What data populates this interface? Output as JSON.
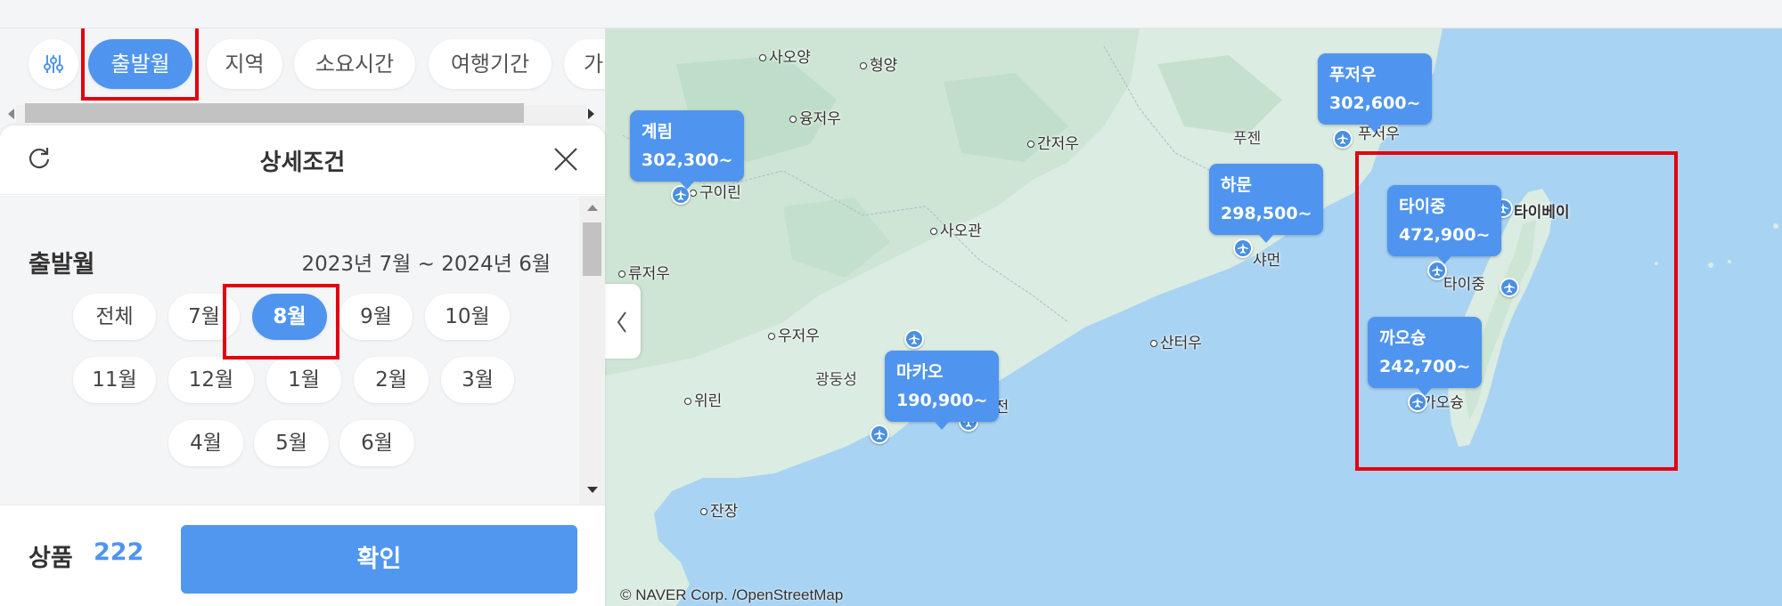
{
  "filters": {
    "chips": [
      "출발월",
      "지역",
      "소요시간",
      "여행기간",
      "가"
    ],
    "active_chip": "출발월"
  },
  "panel": {
    "title": "상세조건",
    "section_title": "출발월",
    "range_text": "2023년 7월 ~ 2024년 6월",
    "months": [
      "전체",
      "7월",
      "8월",
      "9월",
      "10월",
      "11월",
      "12월",
      "1월",
      "2월",
      "3월",
      "4월",
      "5월",
      "6월"
    ],
    "selected_month": "8월",
    "footer": {
      "product_label": "상품",
      "product_count": "222",
      "confirm_label": "확인"
    }
  },
  "map": {
    "attribution": "© NAVER Corp. /OpenStreetMap",
    "labels": [
      "사오양",
      "형양",
      "융저우",
      "간저우",
      "구이린",
      "사오관",
      "류저우",
      "우저우",
      "광둥성",
      "위린",
      "산터우",
      "잔장",
      "푸젠",
      "샤먼",
      "푸저우",
      "타이베이",
      "타이중",
      "가오슝",
      "선전"
    ],
    "price_bubbles": [
      {
        "city": "계림",
        "price": "302,300~"
      },
      {
        "city": "푸저우",
        "price": "302,600~"
      },
      {
        "city": "하문",
        "price": "298,500~"
      },
      {
        "city": "타이중",
        "price": "472,900~"
      },
      {
        "city": "까오슝",
        "price": "242,700~"
      },
      {
        "city": "마카오",
        "price": "190,900~"
      }
    ]
  },
  "colors": {
    "accent": "#4f95ef",
    "highlight": "#e3000f",
    "sea": "#a9d3f2",
    "land": "#dbece2"
  }
}
